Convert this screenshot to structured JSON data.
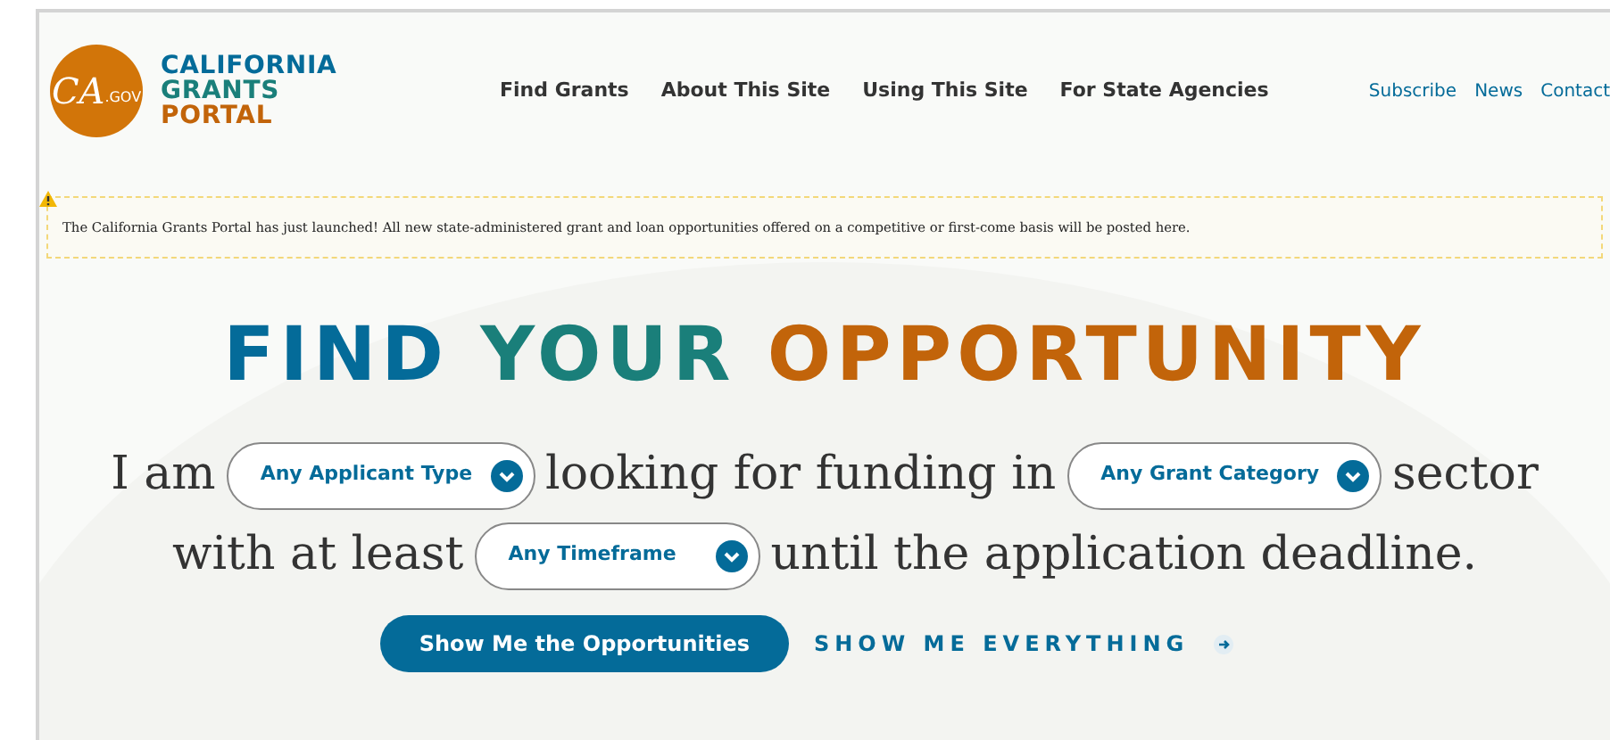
{
  "logo": {
    "badge": "CA",
    "badge_suffix": ".GOV",
    "lines": [
      {
        "text": "CALIFORNIA",
        "color": "#046b99"
      },
      {
        "text": "GRANTS",
        "color": "#1a7f7a"
      },
      {
        "text": "PORTAL",
        "color": "#c2640a"
      }
    ]
  },
  "nav": {
    "main": [
      "Find Grants",
      "About This Site",
      "Using This Site",
      "For State Agencies"
    ],
    "utility": [
      "Subscribe",
      "News",
      "Contact"
    ]
  },
  "alert": {
    "text": "The California Grants Portal has just launched! All new state-administered grant and loan opportunities offered on a competitive or first-come basis will be posted here."
  },
  "headline": [
    {
      "text": "FIND",
      "color": "#046b99"
    },
    {
      "text": "YOUR",
      "color": "#1a7f7a"
    },
    {
      "text": "OPPORTUNITY",
      "color": "#c2640a"
    }
  ],
  "sentence": [
    [
      {
        "kind": "text",
        "text": "I am"
      },
      {
        "kind": "select",
        "text": "Any Applicant Type"
      },
      {
        "kind": "text",
        "text": "looking for funding in"
      },
      {
        "kind": "select",
        "text": "Any Grant Category"
      },
      {
        "kind": "text",
        "text": "sector"
      }
    ],
    [
      {
        "kind": "text",
        "text": "with at least"
      },
      {
        "kind": "select",
        "text": "Any Timeframe"
      },
      {
        "kind": "text",
        "text": "until the application deadline."
      }
    ]
  ],
  "actions": {
    "primary": "Show Me the Opportunities",
    "secondary": "SHOW ME EVERYTHING"
  }
}
